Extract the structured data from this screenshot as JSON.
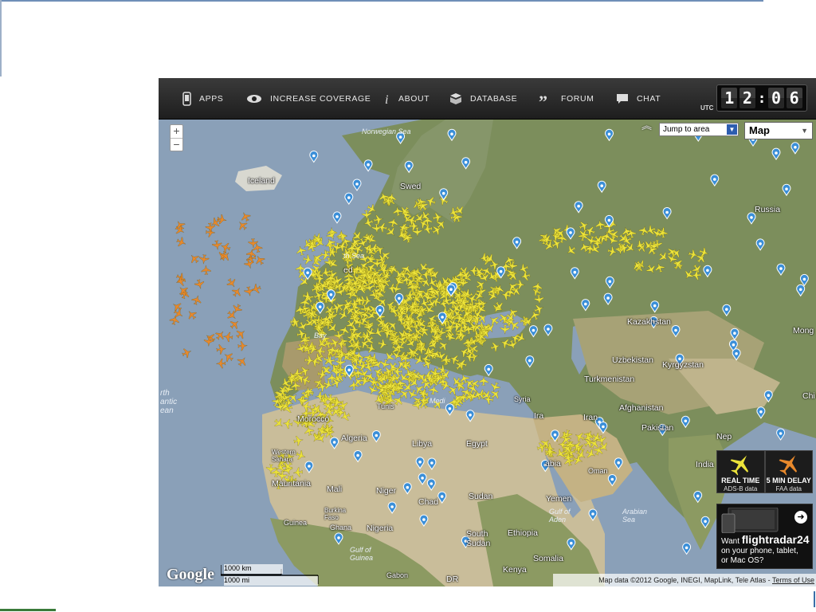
{
  "nav": {
    "items": [
      {
        "label": "APPS",
        "icon": "phone-icon"
      },
      {
        "label": "INCREASE COVERAGE",
        "icon": "eye-icon"
      },
      {
        "label": "ABOUT",
        "icon": "info-icon"
      },
      {
        "label": "DATABASE",
        "icon": "database-icon"
      },
      {
        "label": "FORUM",
        "icon": "quote-icon"
      },
      {
        "label": "CHAT",
        "icon": "chat-bubble-icon"
      }
    ],
    "utc_label": "UTC",
    "clock_digits": [
      "1",
      "2",
      "0",
      "6"
    ]
  },
  "map": {
    "zoom_in": "+",
    "zoom_out": "−",
    "jump_placeholder": "Jump to area",
    "map_type": "Map",
    "labels": {
      "norwegian_sea": "Norwegian Sea",
      "iceland": "Iceland",
      "sweden": "Swed",
      "russia": "Russia",
      "kazakhstan": "Kazakhstan",
      "mongolia": "Mong",
      "uzbekistan": "Uzbekistan",
      "kyrgyzstan": "Kyrgyzstan",
      "turkmenistan": "Turkmenistan",
      "afghanistan": "Afghanistan",
      "iran": "Iran",
      "pakistan": "Pakistan",
      "nepal": "Nep",
      "india": "India",
      "china": "Chi",
      "morocco": "Morocco",
      "western_sahara": "Western Sahara",
      "algeria": "Algeria",
      "libya": "Libya",
      "egypt": "Egypt",
      "mauritania": "Mauritania",
      "mali": "Mali",
      "niger": "Niger",
      "chad": "Chad",
      "sudan": "Sudan",
      "burkina_faso": "Burkina Faso",
      "ghana": "Ghana",
      "guinea": "Guinea",
      "nigeria": "Nigeria",
      "south_sudan": "South Sudan",
      "ethiopia": "Ethiopia",
      "yemen": "Yemen",
      "gulf_of_aden": "Gulf of Aden",
      "oman": "Oman",
      "arabian_sea": "Arabian Sea",
      "somalia": "Somalia",
      "kenya": "Kenya",
      "gabon": "Gabon",
      "dr": "DR",
      "gulf_of_guinea": "Gulf of Guinea",
      "north_atlantic": "rth antic ean",
      "syria": "Syria",
      "arabia": "abia",
      "iraq": "Ira",
      "tunisia": "Tunis",
      "bay": "Bay",
      "north_sea": "th Sea",
      "ireland": "ed",
      "medi": "Medi"
    },
    "logo": "Google",
    "scale_km": "1000 km",
    "scale_mi": "1000 mi",
    "copyright": "Map data ©2012 Google, INEGI, MapLink, Tele Atlas - ",
    "terms": "Terms of Use"
  },
  "legend": {
    "realtime_title": "REAL TIME",
    "realtime_sub": "ADS-B data",
    "delay_title": "5 MIN DELAY",
    "delay_sub": "FAA data"
  },
  "promo": {
    "line1": "Want ",
    "brand": "flightradar24",
    "line2": "on your phone, tablet,",
    "line3": "or Mac OS?"
  },
  "colors": {
    "ocean": "#8aa0b8",
    "land_green": "#7c8e5c",
    "desert": "#c9bd9a",
    "live_plane": "#ece33a",
    "delayed_plane": "#e8892c",
    "airport_pin": "#3b8fd8",
    "nav_bg": "#2a2a2a"
  }
}
